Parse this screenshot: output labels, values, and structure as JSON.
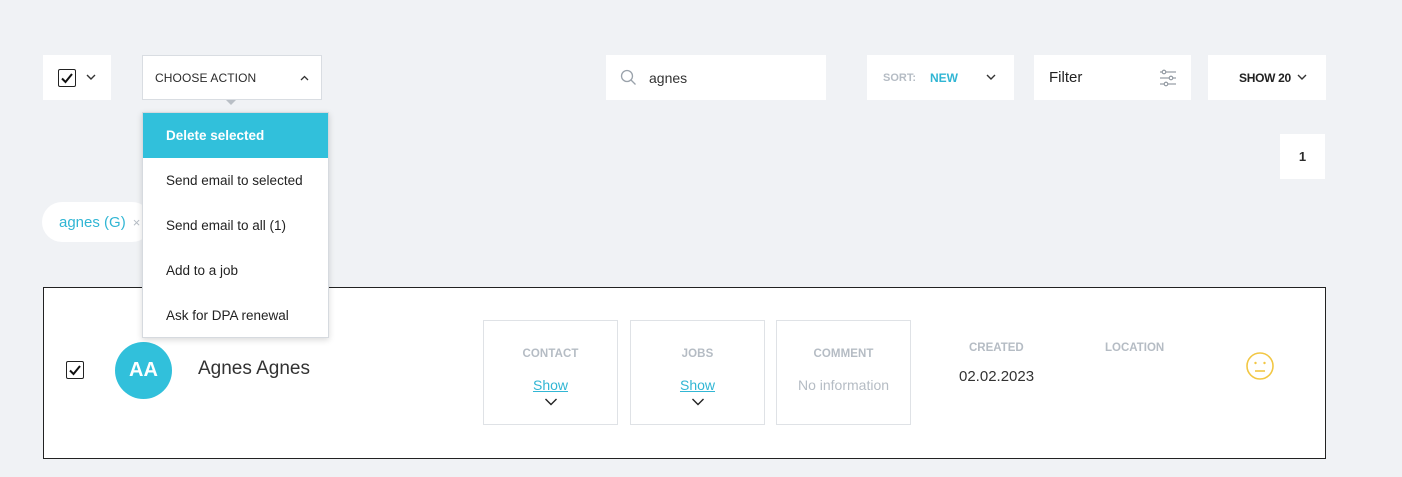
{
  "toolbar": {
    "action_label": "CHOOSE ACTION",
    "search_value": "agnes",
    "sort_key": "SORT:",
    "sort_value": "NEW",
    "filter_label": "Filter",
    "show_label": "SHOW 20"
  },
  "menu": {
    "items": [
      "Delete selected",
      "Send email to selected",
      "Send email to all (1)",
      "Add to a job",
      "Ask for DPA renewal"
    ],
    "active_index": 0
  },
  "pagination": {
    "current": "1"
  },
  "tags": [
    {
      "label": "agnes (G)",
      "remove": "×"
    }
  ],
  "candidate": {
    "initials": "AA",
    "name": "Agnes Agnes",
    "checked": true,
    "contact_header": "CONTACT",
    "contact_link": "Show",
    "jobs_header": "JOBS",
    "jobs_link": "Show",
    "comment_header": "COMMENT",
    "comment_value": "No information",
    "created_header": "CREATED",
    "created_value": "02.02.2023",
    "location_header": "LOCATION",
    "location_value": "",
    "mood_icon": "neutral-face-icon"
  },
  "colors": {
    "accent": "#31c0db",
    "background": "#f0f2f5",
    "muted": "#b5bcc4",
    "mood": "#f2c744"
  }
}
